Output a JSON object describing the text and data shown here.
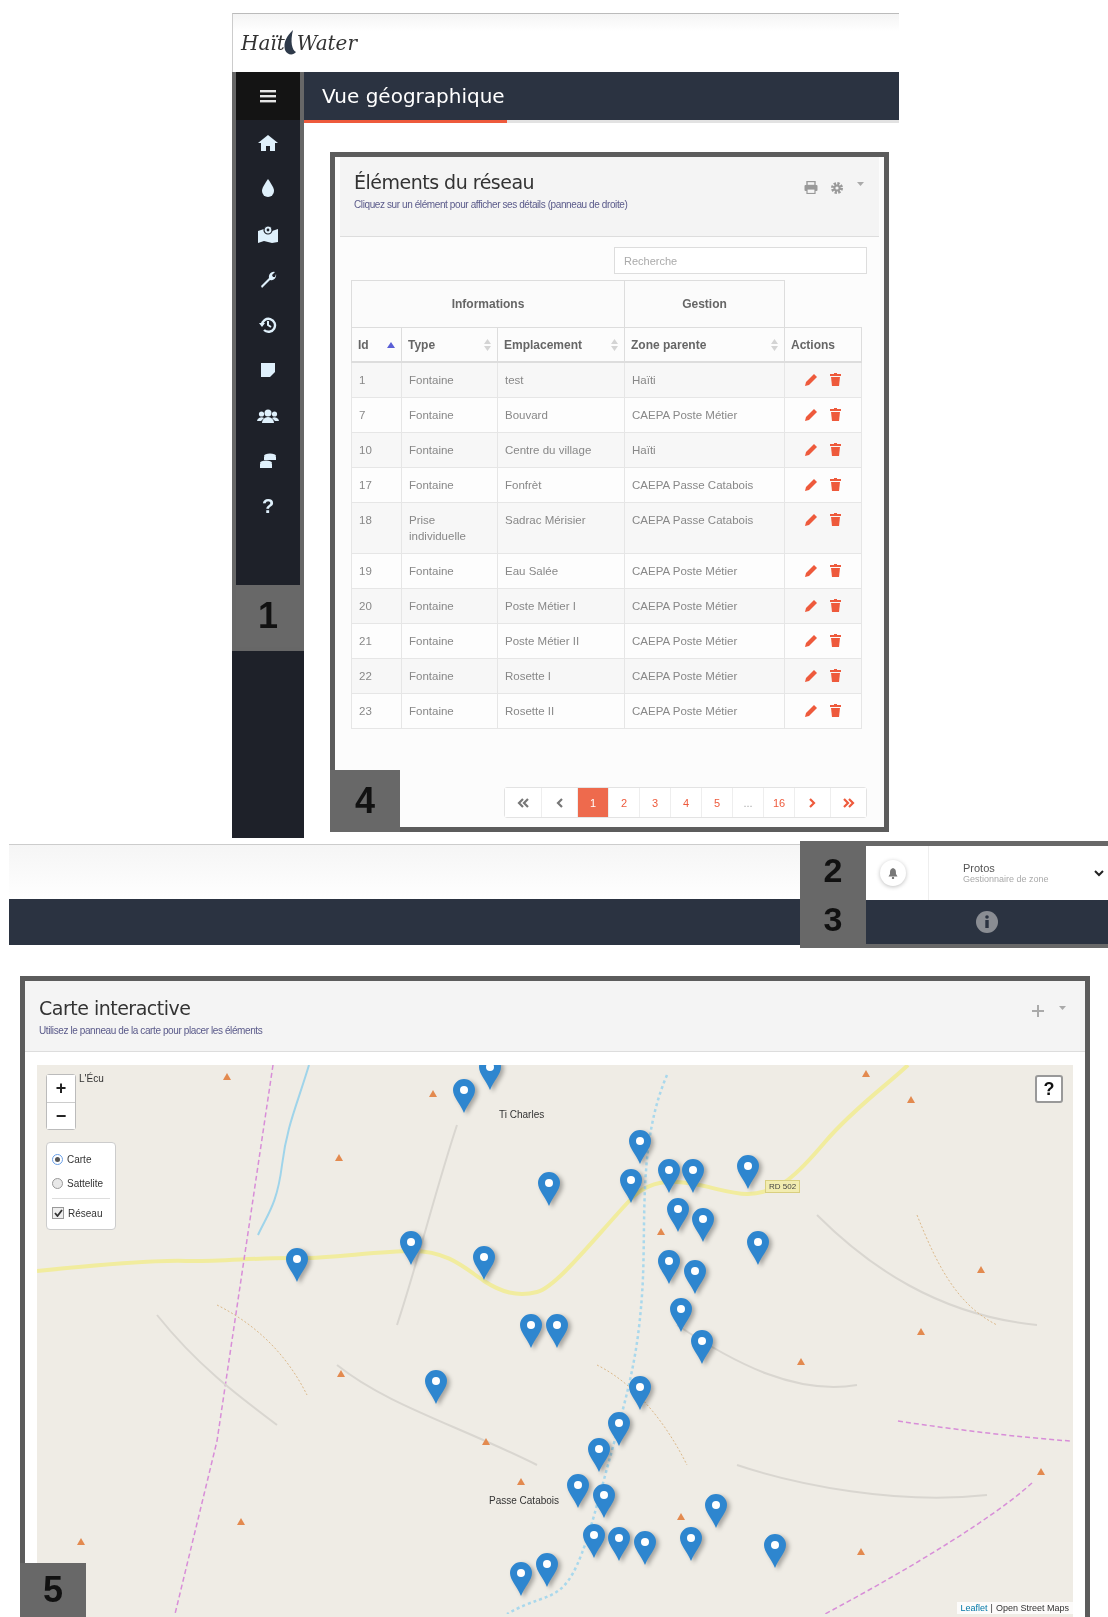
{
  "top_screen": {
    "logo": [
      "Haït",
      "Water"
    ],
    "sidebar_callout": "1",
    "sidebar_help": "?",
    "page_title": "Vue géographique",
    "network_card": {
      "title": "Éléments du réseau",
      "subtitle": "Cliquez sur un élément pour afficher ses détails (panneau de droite)",
      "search": {
        "placeholder": "Recherche"
      },
      "table": {
        "column_groups": [
          {
            "label": "Informations"
          },
          {
            "label": "Gestion"
          }
        ],
        "columns": [
          {
            "label": "Id",
            "sorted": true
          },
          {
            "label": "Type",
            "sorted": false
          },
          {
            "label": "Emplacement",
            "sorted": false
          },
          {
            "label": "Zone parente",
            "sorted": false
          },
          {
            "label": "Actions"
          }
        ],
        "rows": [
          {
            "id": "1",
            "type": "Fontaine",
            "location": "test",
            "parent_zone": "Haïti"
          },
          {
            "id": "7",
            "type": "Fontaine",
            "location": "Bouvard",
            "parent_zone": "CAEPA Poste Métier"
          },
          {
            "id": "10",
            "type": "Fontaine",
            "location": "Centre du village",
            "parent_zone": "Haïti"
          },
          {
            "id": "17",
            "type": "Fontaine",
            "location": "Fonfrèt",
            "parent_zone": "CAEPA Passe Catabois"
          },
          {
            "id": "18",
            "type": "Prise individuelle",
            "location": "Sadrac Mérisier",
            "parent_zone": "CAEPA Passe Catabois"
          },
          {
            "id": "19",
            "type": "Fontaine",
            "location": "Eau Salée",
            "parent_zone": "CAEPA Poste Métier"
          },
          {
            "id": "20",
            "type": "Fontaine",
            "location": "Poste Métier I",
            "parent_zone": "CAEPA Poste Métier"
          },
          {
            "id": "21",
            "type": "Fontaine",
            "location": "Poste Métier II",
            "parent_zone": "CAEPA Poste Métier"
          },
          {
            "id": "22",
            "type": "Fontaine",
            "location": "Rosette I",
            "parent_zone": "CAEPA Poste Métier"
          },
          {
            "id": "23",
            "type": "Fontaine",
            "location": "Rosette II",
            "parent_zone": "CAEPA Poste Métier"
          }
        ]
      },
      "pagination": [
        {
          "label": "1",
          "kind": "page",
          "selected": true
        },
        {
          "label": "2",
          "kind": "page",
          "selected": false
        },
        {
          "label": "3",
          "kind": "page",
          "selected": false
        },
        {
          "label": "4",
          "kind": "page",
          "selected": false
        },
        {
          "label": "5",
          "kind": "page",
          "selected": false
        },
        {
          "label": "...",
          "kind": "ellipsis",
          "selected": false
        },
        {
          "label": "16",
          "kind": "page",
          "selected": false
        }
      ],
      "callout": "4"
    }
  },
  "user_bar": {
    "callouts": [
      "2",
      "3"
    ],
    "user_name": "Protos",
    "user_role": "Gestionnaire de zone"
  },
  "map_card": {
    "title": "Carte interactive",
    "subtitle": "Utilisez le panneau de la carte pour placer les éléments",
    "zoom_in": "+",
    "zoom_out": "−",
    "layers": [
      {
        "label": "Carte",
        "kind": "radio",
        "selected": true
      },
      {
        "label": "Sattelite",
        "kind": "radio",
        "selected": false
      },
      {
        "label": "Réseau",
        "kind": "checkbox",
        "checked": true
      }
    ],
    "help": "?",
    "place_labels": [
      "L'Écu",
      "Ti Charles",
      "Passe Catabois"
    ],
    "road_label": "RD 502",
    "attribution": {
      "link": "Leaflet",
      "separator": "|",
      "text": "Open Street Maps"
    },
    "callout": "5"
  }
}
